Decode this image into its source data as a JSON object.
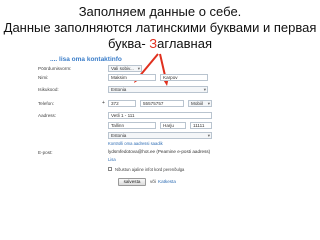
{
  "caption": {
    "line1": "Заполняем данные о себе.",
    "line2": "Данные заполняются латинскими буквами и первая",
    "line3_before": "буква- ",
    "line3_highlight": "З",
    "line3_after": "аглавная"
  },
  "form": {
    "title": ".... lisa oma kontaktinfo",
    "labels": {
      "title_label": "Pöördumisvorm:",
      "name": "Nimi:",
      "country": "Isikukood:",
      "phone": "Telefon:",
      "address": "Aadress:",
      "email": "E-post:"
    },
    "fields": {
      "salutation": "Vali sobiv...",
      "first_name": "Maksim",
      "last_name": "Karpov",
      "country": "Estonia",
      "phone_code": "372",
      "phone_number": "55575757",
      "phone_type": "Mobiil",
      "street": "Vetli 1 - 111",
      "city": "Tallinn",
      "county": "Harju",
      "zip": "11111",
      "address_country": "Estonia",
      "email": "lydsmfedotova@hot.ee (Peamine e-posti aadress)"
    },
    "plus_sign": "+",
    "link_check_address": "Kontrolli oma aadressi saadik",
    "link_add_email": "Lisa",
    "checkbox_text": "Nõustun ajaline infot kord perenõulga",
    "save_button": "salvesta",
    "or_text": "või",
    "cancel_link": "Katkesta"
  },
  "colors": {
    "accent": "#3a7dc9",
    "highlight": "#e0301e",
    "arrow": "#e0301e"
  }
}
